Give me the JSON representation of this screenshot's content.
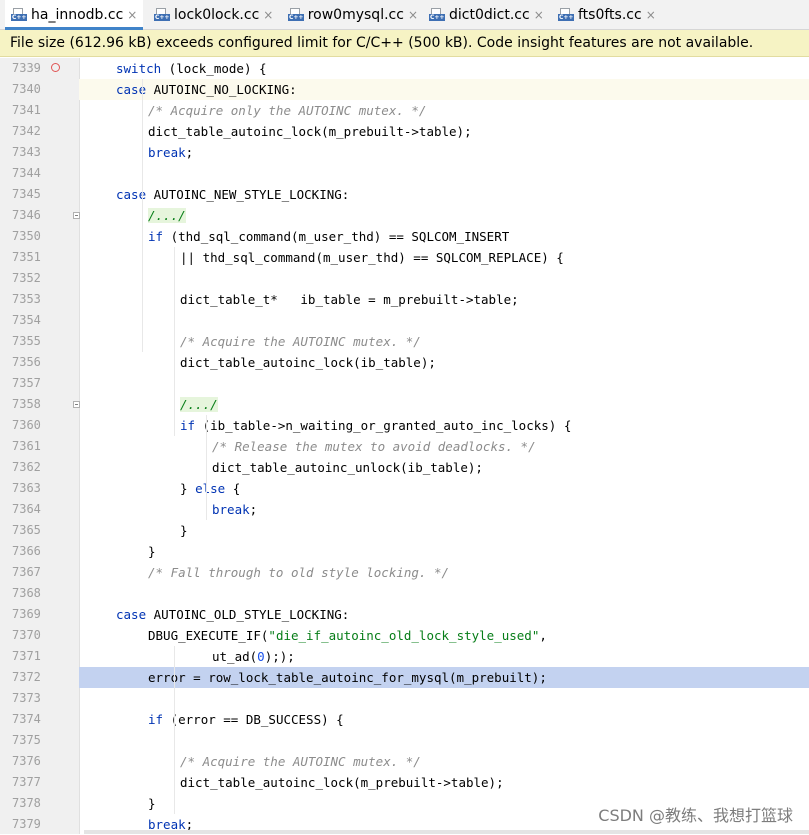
{
  "tabs": [
    {
      "label": "ha_innodb.cc",
      "icon": "cpp-file-icon",
      "icon_text": "C++",
      "active": true
    },
    {
      "label": "lock0lock.cc",
      "icon": "cpp-file-icon",
      "icon_text": "C++",
      "active": false
    },
    {
      "label": "row0mysql.cc",
      "icon": "cpp-file-icon",
      "icon_text": "C++",
      "active": false
    },
    {
      "label": "dict0dict.cc",
      "icon": "cpp-file-icon",
      "icon_text": "C++",
      "active": false
    },
    {
      "label": "fts0fts.cc",
      "icon": "cpp-file-icon",
      "icon_text": "C++",
      "active": false
    }
  ],
  "close_glyph": "×",
  "banner": {
    "text": "File size (612.96 kB) exceeds configured limit for C/C++ (500 kB). Code insight features are not available."
  },
  "editor": {
    "colors": {
      "keyword": "#0033b3",
      "comment": "#8c8c8c",
      "string": "#067d17",
      "number": "#1750eb",
      "selection": "#c3d2f0",
      "banner": "#f6f3c4"
    },
    "lines": [
      {
        "num": "7339",
        "indent": 1,
        "marker": "breakpoint",
        "tokens": [
          {
            "t": "kw",
            "v": "switch"
          },
          {
            "t": "p",
            "v": " (lock_mode) {"
          }
        ]
      },
      {
        "num": "7340",
        "indent": 1,
        "state": "caret",
        "tokens": [
          {
            "t": "kw",
            "v": "case"
          },
          {
            "t": "p",
            "v": " AUTOINC_NO_LOCKING:"
          }
        ]
      },
      {
        "num": "7341",
        "indent": 2,
        "tokens": [
          {
            "t": "cm",
            "v": "/* Acquire only the AUTOINC mutex. */"
          }
        ]
      },
      {
        "num": "7342",
        "indent": 2,
        "tokens": [
          {
            "t": "p",
            "v": "dict_table_autoinc_lock(m_prebuilt->table);"
          }
        ]
      },
      {
        "num": "7343",
        "indent": 2,
        "tokens": [
          {
            "t": "kw",
            "v": "break"
          },
          {
            "t": "p",
            "v": ";"
          }
        ]
      },
      {
        "num": "7344",
        "indent": 0,
        "tokens": []
      },
      {
        "num": "7345",
        "indent": 1,
        "tokens": [
          {
            "t": "kw",
            "v": "case"
          },
          {
            "t": "p",
            "v": " AUTOINC_NEW_STYLE_LOCKING:"
          }
        ]
      },
      {
        "num": "7346",
        "indent": 2,
        "marker": "fold",
        "tokens": [
          {
            "t": "fold",
            "v": "/.../"
          }
        ]
      },
      {
        "num": "7350",
        "indent": 2,
        "tokens": [
          {
            "t": "kw",
            "v": "if"
          },
          {
            "t": "p",
            "v": " (thd_sql_command(m_user_thd) == SQLCOM_INSERT"
          }
        ]
      },
      {
        "num": "7351",
        "indent": 3,
        "tokens": [
          {
            "t": "p",
            "v": "|| thd_sql_command(m_user_thd) == SQLCOM_REPLACE) {"
          }
        ]
      },
      {
        "num": "7352",
        "indent": 0,
        "tokens": []
      },
      {
        "num": "7353",
        "indent": 3,
        "tokens": [
          {
            "t": "p",
            "v": "dict_table_t*   ib_table = m_prebuilt->table;"
          }
        ]
      },
      {
        "num": "7354",
        "indent": 0,
        "tokens": []
      },
      {
        "num": "7355",
        "indent": 3,
        "tokens": [
          {
            "t": "cm",
            "v": "/* Acquire the AUTOINC mutex. */"
          }
        ]
      },
      {
        "num": "7356",
        "indent": 3,
        "tokens": [
          {
            "t": "p",
            "v": "dict_table_autoinc_lock(ib_table);"
          }
        ]
      },
      {
        "num": "7357",
        "indent": 0,
        "tokens": []
      },
      {
        "num": "7358",
        "indent": 3,
        "marker": "fold",
        "tokens": [
          {
            "t": "fold",
            "v": "/.../"
          }
        ]
      },
      {
        "num": "7360",
        "indent": 3,
        "tokens": [
          {
            "t": "kw",
            "v": "if"
          },
          {
            "t": "p",
            "v": " (ib_table->n_waiting_or_granted_auto_inc_locks) {"
          }
        ]
      },
      {
        "num": "7361",
        "indent": 4,
        "tokens": [
          {
            "t": "cm",
            "v": "/* Release the mutex to avoid deadlocks. */"
          }
        ]
      },
      {
        "num": "7362",
        "indent": 4,
        "tokens": [
          {
            "t": "p",
            "v": "dict_table_autoinc_unlock(ib_table);"
          }
        ]
      },
      {
        "num": "7363",
        "indent": 3,
        "tokens": [
          {
            "t": "p",
            "v": "} "
          },
          {
            "t": "kw",
            "v": "else"
          },
          {
            "t": "p",
            "v": " {"
          }
        ]
      },
      {
        "num": "7364",
        "indent": 4,
        "tokens": [
          {
            "t": "kw",
            "v": "break"
          },
          {
            "t": "p",
            "v": ";"
          }
        ]
      },
      {
        "num": "7365",
        "indent": 3,
        "tokens": [
          {
            "t": "p",
            "v": "}"
          }
        ]
      },
      {
        "num": "7366",
        "indent": 2,
        "tokens": [
          {
            "t": "p",
            "v": "}"
          }
        ]
      },
      {
        "num": "7367",
        "indent": 2,
        "tokens": [
          {
            "t": "cm",
            "v": "/* Fall through to old style locking. */"
          }
        ]
      },
      {
        "num": "7368",
        "indent": 0,
        "tokens": []
      },
      {
        "num": "7369",
        "indent": 1,
        "tokens": [
          {
            "t": "kw",
            "v": "case"
          },
          {
            "t": "p",
            "v": " AUTOINC_OLD_STYLE_LOCKING:"
          }
        ]
      },
      {
        "num": "7370",
        "indent": 2,
        "tokens": [
          {
            "t": "p",
            "v": "DBUG_EXECUTE_IF("
          },
          {
            "t": "str",
            "v": "\"die_if_autoinc_old_lock_style_used\""
          },
          {
            "t": "p",
            "v": ","
          }
        ]
      },
      {
        "num": "7371",
        "indent": 4,
        "tokens": [
          {
            "t": "p",
            "v": "ut_ad("
          },
          {
            "t": "num",
            "v": "0"
          },
          {
            "t": "p",
            "v": ");"
          },
          {
            "t": "p",
            "v": ");"
          }
        ]
      },
      {
        "num": "7372",
        "indent": 2,
        "state": "selected",
        "tokens": [
          {
            "t": "p",
            "v": "error = row_lock_table_autoinc_for_mysql(m_prebuilt);"
          }
        ]
      },
      {
        "num": "7373",
        "indent": 0,
        "tokens": []
      },
      {
        "num": "7374",
        "indent": 2,
        "tokens": [
          {
            "t": "kw",
            "v": "if"
          },
          {
            "t": "p",
            "v": " (error == DB_SUCCESS) {"
          }
        ]
      },
      {
        "num": "7375",
        "indent": 0,
        "tokens": []
      },
      {
        "num": "7376",
        "indent": 3,
        "tokens": [
          {
            "t": "cm",
            "v": "/* Acquire the AUTOINC mutex. */"
          }
        ]
      },
      {
        "num": "7377",
        "indent": 3,
        "tokens": [
          {
            "t": "p",
            "v": "dict_table_autoinc_lock(m_prebuilt->table);"
          }
        ]
      },
      {
        "num": "7378",
        "indent": 2,
        "tokens": [
          {
            "t": "p",
            "v": "}"
          }
        ]
      },
      {
        "num": "7379",
        "indent": 2,
        "tokens": [
          {
            "t": "kw",
            "v": "break"
          },
          {
            "t": "p",
            "v": ";"
          }
        ]
      }
    ]
  },
  "watermark": "CSDN @教练、我想打篮球"
}
